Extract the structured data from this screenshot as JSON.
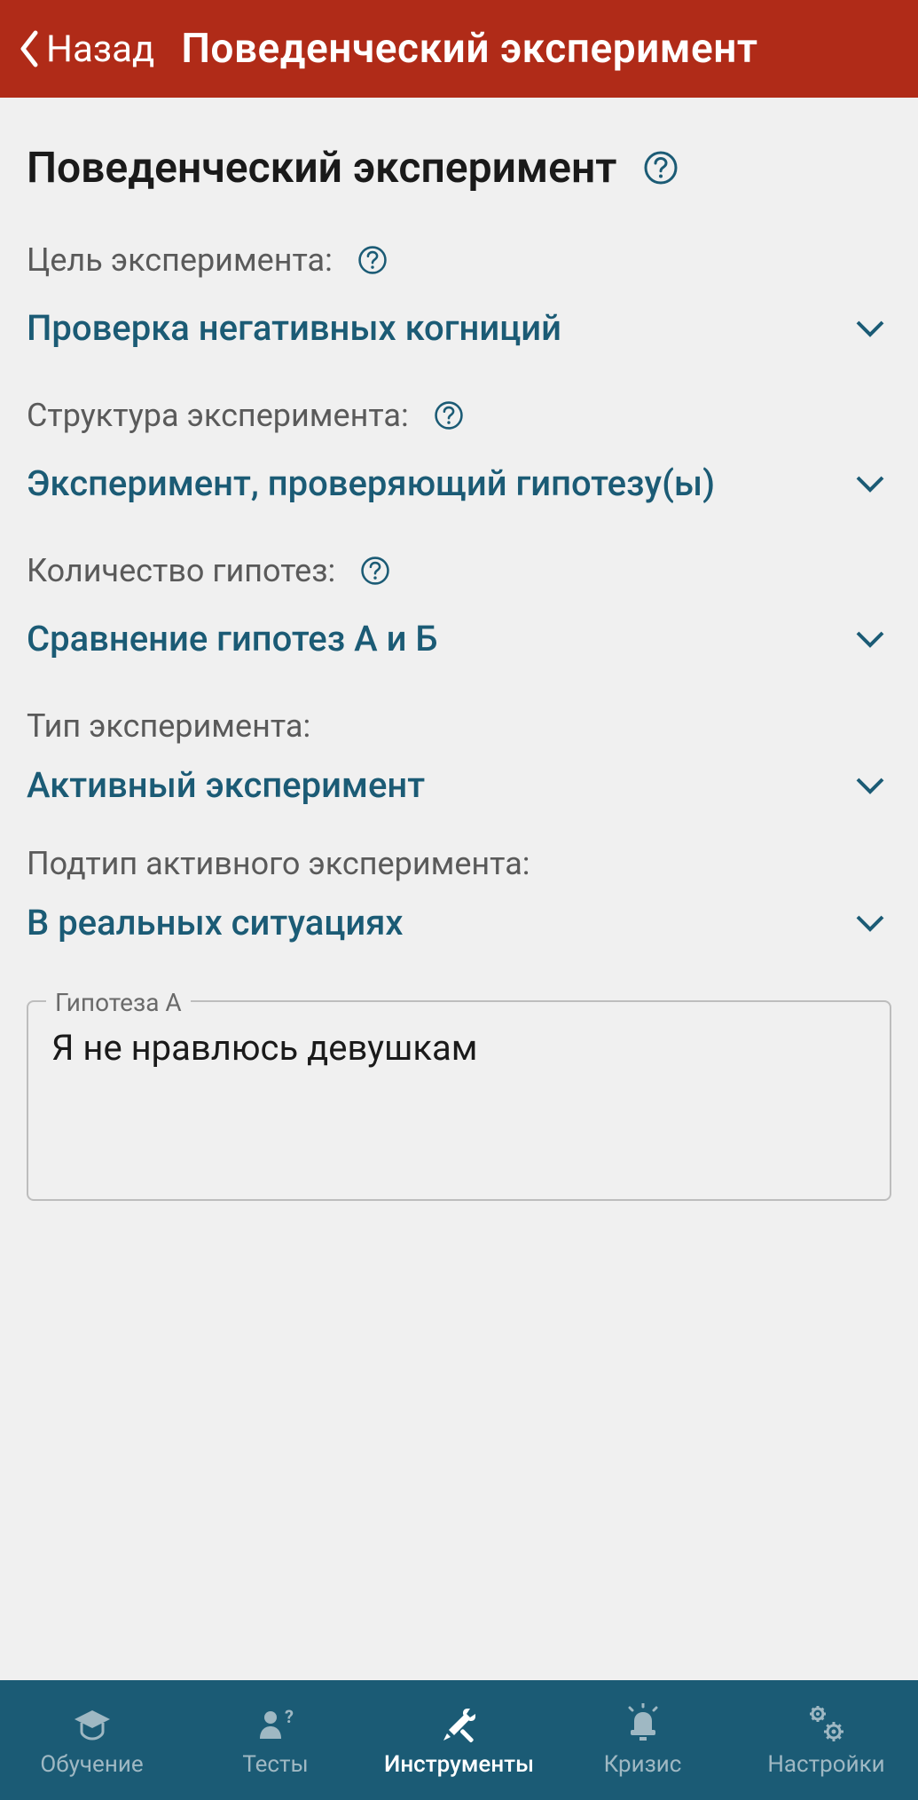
{
  "header": {
    "back_label": "Назад",
    "title": "Поведенческий эксперимент"
  },
  "page": {
    "title": "Поведенческий эксперимент"
  },
  "fields": {
    "goal": {
      "label": "Цель эксперимента:",
      "value": "Проверка негативных когниций"
    },
    "structure": {
      "label": "Структура эксперимента:",
      "value": "Эксперимент, проверяющий гипотезу(ы)"
    },
    "hypothesis_count": {
      "label": "Количество гипотез:",
      "value": "Сравнение гипотез А и Б"
    },
    "type": {
      "label": "Тип эксперимента:",
      "value": "Активный эксперимент"
    },
    "subtype": {
      "label": "Подтип активного эксперимента:",
      "value": "В реальных ситуациях"
    }
  },
  "hypothesis_a": {
    "legend": "Гипотеза А",
    "value": "Я не нравлюсь девушкам"
  },
  "nav": {
    "items": [
      {
        "label": "Обучение",
        "icon": "education-icon"
      },
      {
        "label": "Тесты",
        "icon": "tests-icon"
      },
      {
        "label": "Инструменты",
        "icon": "tools-icon"
      },
      {
        "label": "Кризис",
        "icon": "crisis-icon"
      },
      {
        "label": "Настройки",
        "icon": "settings-icon"
      }
    ],
    "active_index": 2
  },
  "colors": {
    "header_bg": "#b02b18",
    "accent": "#1b5b75",
    "nav_bg": "#1b5b75"
  }
}
